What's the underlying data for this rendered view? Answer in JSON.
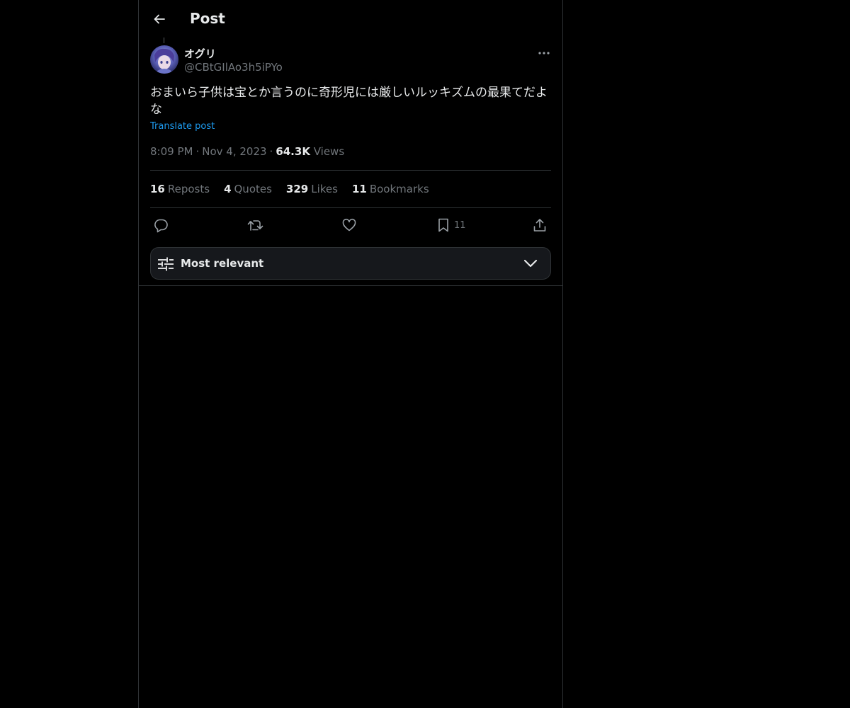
{
  "header": {
    "title": "Post"
  },
  "post": {
    "author": {
      "display_name": "オグリ",
      "handle": "@CBtGIlAo3h5iPYo"
    },
    "text": "おまいら子供は宝とか言うのに奇形児には厳しいルッキズムの最果てだよな",
    "translate_label": "Translate post",
    "time": "8:09 PM",
    "date": "Nov 4, 2023",
    "views_count": "64.3K",
    "views_label": "Views"
  },
  "stats": {
    "reposts": {
      "count": "16",
      "label": "Reposts"
    },
    "quotes": {
      "count": "4",
      "label": "Quotes"
    },
    "likes": {
      "count": "329",
      "label": "Likes"
    },
    "bookmarks": {
      "count": "11",
      "label": "Bookmarks"
    }
  },
  "actions": {
    "bookmark_count": "11"
  },
  "sort": {
    "label": "Most relevant"
  },
  "icons": {
    "back": "arrow-left-icon",
    "more": "ellipsis-icon",
    "reply": "speech-bubble-icon",
    "repost": "repost-arrows-icon",
    "like": "heart-icon",
    "bookmark": "bookmark-icon",
    "share": "share-upload-icon",
    "sort": "sliders-icon",
    "chevron": "chevron-down-icon"
  },
  "colors": {
    "background": "#000000",
    "text_primary": "#e7e9ea",
    "text_secondary": "#71767b",
    "link": "#1d9bf0",
    "border": "#2f3336",
    "sort_bar_bg": "#16181c"
  }
}
